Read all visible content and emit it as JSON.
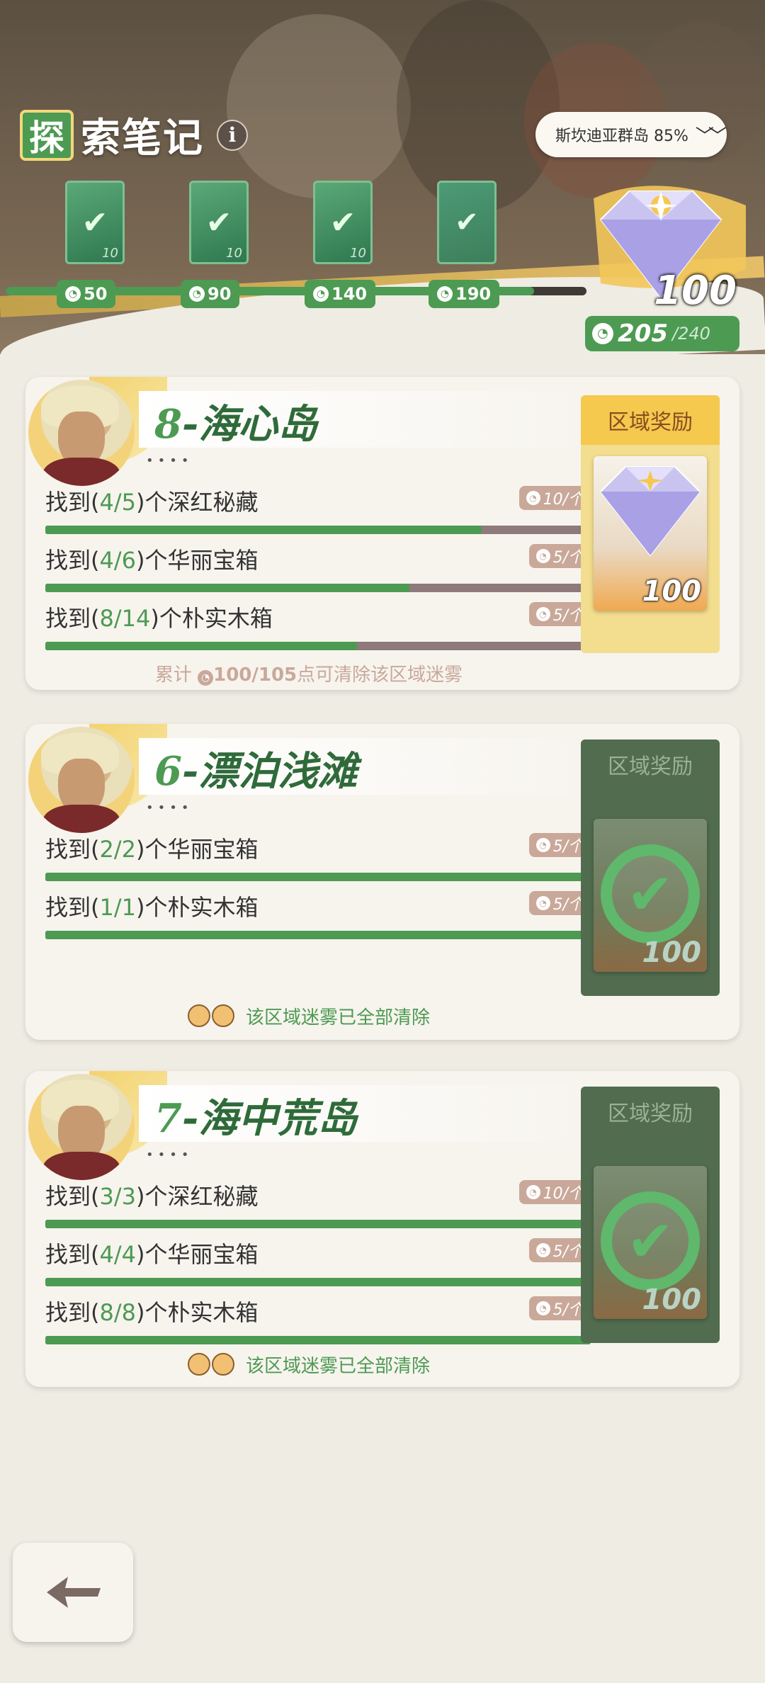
{
  "header": {
    "title_badge": "探",
    "title": "索笔记",
    "info_icon": "i",
    "region_selector": "斯坎迪亚群岛 85%"
  },
  "milestones": [
    {
      "cost": "50",
      "count": "10",
      "claimed": true
    },
    {
      "cost": "90",
      "count": "10",
      "claimed": true
    },
    {
      "cost": "140",
      "count": "10",
      "claimed": true
    },
    {
      "cost": "190",
      "count": "",
      "claimed": false
    }
  ],
  "milestone_progress": 0.91,
  "big_reward": {
    "amount": "100"
  },
  "points": {
    "current": "205",
    "total": "/240"
  },
  "regions": [
    {
      "title_num": "8",
      "title_name": "-海心岛",
      "dots": "••••",
      "tasks": [
        {
          "pre": "找到(",
          "nums": "4/5",
          "post": ")个深红秘藏",
          "reward": "10/个",
          "progress": 0.8
        },
        {
          "pre": "找到(",
          "nums": "4/6",
          "post": ")个华丽宝箱",
          "reward": "5/个",
          "progress": 0.667
        },
        {
          "pre": "找到(",
          "nums": "8/14",
          "post": ")个朴实木箱",
          "reward": "5/个",
          "progress": 0.571
        }
      ],
      "foot_pre": "累计",
      "foot_value": "100/105",
      "foot_post": "点可清除该区域迷雾",
      "reward_title": "区域奖励",
      "reward_amount": "100"
    },
    {
      "title_num": "6",
      "title_name": "-漂泊浅滩",
      "dots": "••••",
      "tasks": [
        {
          "pre": "找到(",
          "nums": "2/2",
          "post": ")个华丽宝箱",
          "reward": "5/个",
          "progress": 1
        },
        {
          "pre": "找到(",
          "nums": "1/1",
          "post": ")个朴实木箱",
          "reward": "5/个",
          "progress": 1
        }
      ],
      "foot_done": "该区域迷雾已全部清除",
      "reward_title": "区域奖励",
      "reward_amount": "100"
    },
    {
      "title_num": "7",
      "title_name": "-海中荒岛",
      "dots": "••••",
      "tasks": [
        {
          "pre": "找到(",
          "nums": "3/3",
          "post": ")个深红秘藏",
          "reward": "10/个",
          "progress": 1
        },
        {
          "pre": "找到(",
          "nums": "4/4",
          "post": ")个华丽宝箱",
          "reward": "5/个",
          "progress": 1
        },
        {
          "pre": "找到(",
          "nums": "8/8",
          "post": ")个朴实木箱",
          "reward": "5/个",
          "progress": 1
        }
      ],
      "foot_done": "该区域迷雾已全部清除",
      "reward_title": "区域奖励",
      "reward_amount": "100"
    }
  ],
  "colors": {
    "accent_green": "#4d9a52",
    "gold": "#f5c84e",
    "reward_tag": "#c9a89a"
  },
  "back_button": {
    "icon": "back-arrow-icon"
  }
}
